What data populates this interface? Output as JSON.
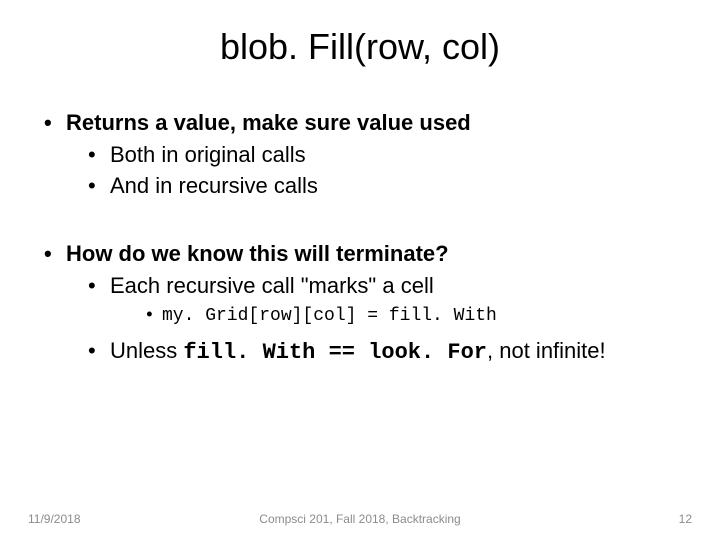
{
  "title": "blob. Fill(row, col)",
  "bullets": {
    "b1": "Returns a value, make sure value used",
    "b1_1": "Both in original calls",
    "b1_2": "And in recursive calls",
    "b2": "How do we know this will terminate?",
    "b2_1": "Each recursive call \"marks\" a cell",
    "b2_1_1": "my. Grid[row][col] = fill. With",
    "b2_2_pre": "Unless ",
    "b2_2_code": "fill. With == look. For",
    "b2_2_post": ", not infinite!"
  },
  "footer": {
    "date": "11/9/2018",
    "center": "Compsci 201, Fall 2018, Backtracking",
    "page": "12"
  }
}
